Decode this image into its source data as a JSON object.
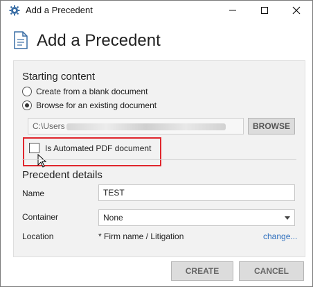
{
  "window": {
    "title": "Add a Precedent"
  },
  "header": {
    "title": "Add a Precedent"
  },
  "starting_content": {
    "title": "Starting content",
    "options": [
      {
        "label": "Create from a blank document",
        "checked": false
      },
      {
        "label": "Browse for an existing document",
        "checked": true
      }
    ],
    "path_prefix": "C:\\Users",
    "browse_label": "BROWSE",
    "automated_pdf_label": "Is Automated PDF document",
    "automated_pdf_checked": false
  },
  "precedent_details": {
    "title": "Precedent details",
    "name_label": "Name",
    "name_value": "TEST",
    "container_label": "Container",
    "container_value": "None",
    "location_label": "Location",
    "location_value": "* Firm name / Litigation",
    "change_label": "change..."
  },
  "footer": {
    "create_label": "CREATE",
    "cancel_label": "CANCEL"
  },
  "colors": {
    "highlight": "#e0262d",
    "link": "#2e6fbd",
    "panel": "#f2f2f2"
  }
}
